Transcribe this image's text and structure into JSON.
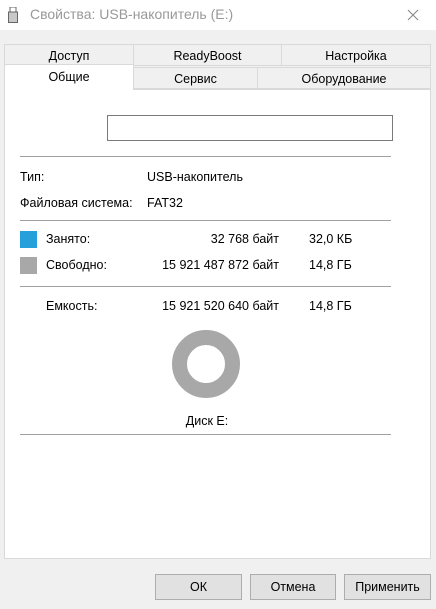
{
  "window": {
    "title": "Свойства: USB-накопитель (E:)",
    "close_icon": "close-icon"
  },
  "tabs": {
    "row1": [
      "Доступ",
      "ReadyBoost",
      "Настройка"
    ],
    "row2": [
      "Общие",
      "Сервис",
      "Оборудование"
    ],
    "active": "Общие"
  },
  "general": {
    "volume_name_value": "",
    "type_label": "Тип:",
    "type_value": "USB-накопитель",
    "fs_label": "Файловая система:",
    "fs_value": "FAT32",
    "used_label": "Занято:",
    "used_bytes": "32 768 байт",
    "used_size": "32,0 КБ",
    "used_color": "#26a0da",
    "free_label": "Свободно:",
    "free_bytes": "15 921 487 872 байт",
    "free_size": "14,8 ГБ",
    "free_color": "#a8a8a8",
    "capacity_label": "Емкость:",
    "capacity_bytes": "15 921 520 640 байт",
    "capacity_size": "14,8 ГБ",
    "disk_label": "Диск E:",
    "used_fraction": 2e-06
  },
  "buttons": {
    "ok": "ОК",
    "cancel": "Отмена",
    "apply": "Применить"
  }
}
